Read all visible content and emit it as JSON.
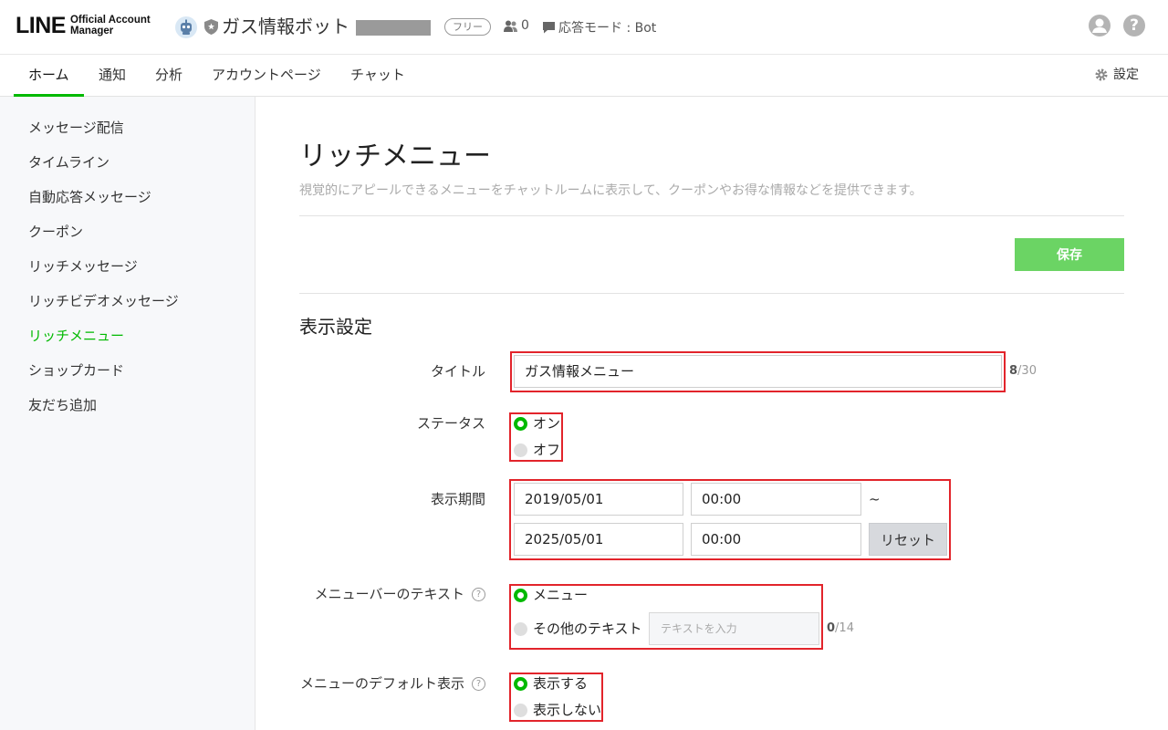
{
  "header": {
    "logo_main": "LINE",
    "logo_sub_1": "Official Account",
    "logo_sub_2": "Manager",
    "account_name": "ガス情報ボット",
    "plan_badge": "フリー",
    "friends_count": "0",
    "mode_label": "応答モード : Bot",
    "help_glyph": "?"
  },
  "nav": {
    "tabs": [
      "ホーム",
      "通知",
      "分析",
      "アカウントページ",
      "チャット"
    ],
    "active_tab": "ホーム",
    "settings_label": "設定"
  },
  "sidebar": {
    "items": [
      "メッセージ配信",
      "タイムライン",
      "自動応答メッセージ",
      "クーポン",
      "リッチメッセージ",
      "リッチビデオメッセージ",
      "リッチメニュー",
      "ショップカード",
      "友だち追加"
    ],
    "active_item": "リッチメニュー"
  },
  "main": {
    "title": "リッチメニュー",
    "description": "視覚的にアピールできるメニューをチャットルームに表示して、クーポンやお得な情報などを提供できます。",
    "save_label": "保存",
    "section_title": "表示設定",
    "title_field": {
      "label": "タイトル",
      "value": "ガス情報メニュー",
      "count": "8",
      "max": "/30"
    },
    "status": {
      "label": "ステータス",
      "options": [
        "オン",
        "オフ"
      ],
      "selected": "オン"
    },
    "period": {
      "label": "表示期間",
      "start_date": "2019/05/01",
      "start_time": "00:00",
      "separator": "~",
      "end_date": "2025/05/01",
      "end_time": "00:00",
      "reset_label": "リセット"
    },
    "menubar_text": {
      "label": "メニューバーのテキスト",
      "option_menu": "メニュー",
      "option_other": "その他のテキスト",
      "placeholder": "テキストを入力",
      "count": "0",
      "max": "/14",
      "selected": "メニュー"
    },
    "default_display": {
      "label": "メニューのデフォルト表示",
      "options": [
        "表示する",
        "表示しない"
      ],
      "selected": "表示する"
    }
  },
  "colors": {
    "accent_green": "#00b900",
    "save_button": "#6bd464",
    "highlight_red": "#e2242b"
  }
}
